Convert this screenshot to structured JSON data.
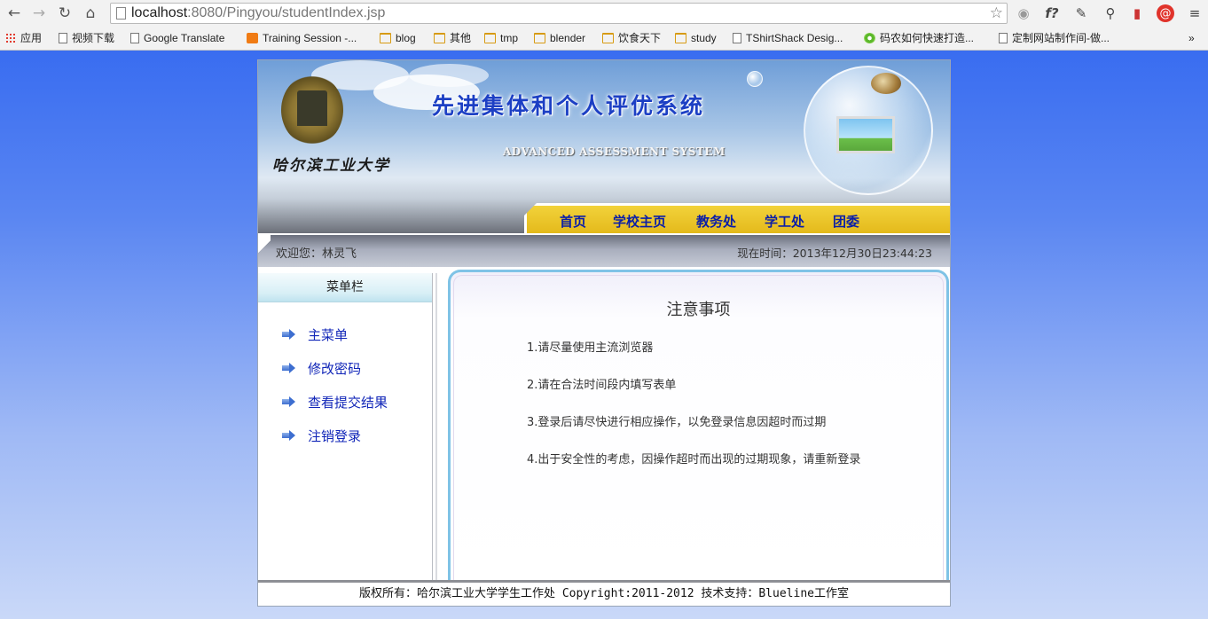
{
  "browser": {
    "url_host": "localhost",
    "url_path": ":8080/Pingyou/studentIndex.jsp",
    "bookmarks": [
      {
        "label": "应用",
        "icon": "apps-icon"
      },
      {
        "label": "视频下载",
        "icon": "page-icon"
      },
      {
        "label": "Google Translate",
        "icon": "page-icon"
      },
      {
        "label": "Training Session -...",
        "icon": "orange-icon"
      },
      {
        "label": "blog",
        "icon": "folder-icon"
      },
      {
        "label": "其他",
        "icon": "folder-icon"
      },
      {
        "label": "tmp",
        "icon": "folder-icon"
      },
      {
        "label": "blender",
        "icon": "folder-icon"
      },
      {
        "label": "饮食天下",
        "icon": "folder-icon"
      },
      {
        "label": "study",
        "icon": "folder-icon"
      },
      {
        "label": "TShirtShack Desig...",
        "icon": "page-icon"
      },
      {
        "label": "码农如何快速打造...",
        "icon": "green-icon"
      },
      {
        "label": "定制网站制作间-做...",
        "icon": "page-icon"
      }
    ],
    "more_label": "»"
  },
  "header": {
    "university": "哈尔滨工业大学",
    "system_title": "先进集体和个人评优系统",
    "system_subtitle": "ADVANCED ASSESSMENT SYSTEM",
    "nav": [
      "首页",
      "学校主页",
      "教务处",
      "学工处",
      "团委"
    ]
  },
  "status": {
    "welcome": "欢迎您：林灵飞",
    "time": "现在时间：2013年12月30日23:44:23"
  },
  "sidebar": {
    "title": "菜单栏",
    "items": [
      "主菜单",
      "修改密码",
      "查看提交结果",
      "注销登录"
    ]
  },
  "content": {
    "title": "注意事项",
    "items": [
      "1.请尽量使用主流浏览器",
      "2.请在合法时间段内填写表单",
      "3.登录后请尽快进行相应操作，以免登录信息因超时而过期",
      "4.出于安全性的考虑，因操作超时而出现的过期现象，请重新登录"
    ]
  },
  "footer": {
    "text": "版权所有：哈尔滨工业大学学生工作处  Copyright:2011-2012  技术支持：Blueline工作室"
  },
  "colors": {
    "page_bg_top": "#2f65f0",
    "nav_yellow": "#e8c020",
    "link_blue": "#1126b8",
    "content_border": "#7fc3e6"
  }
}
